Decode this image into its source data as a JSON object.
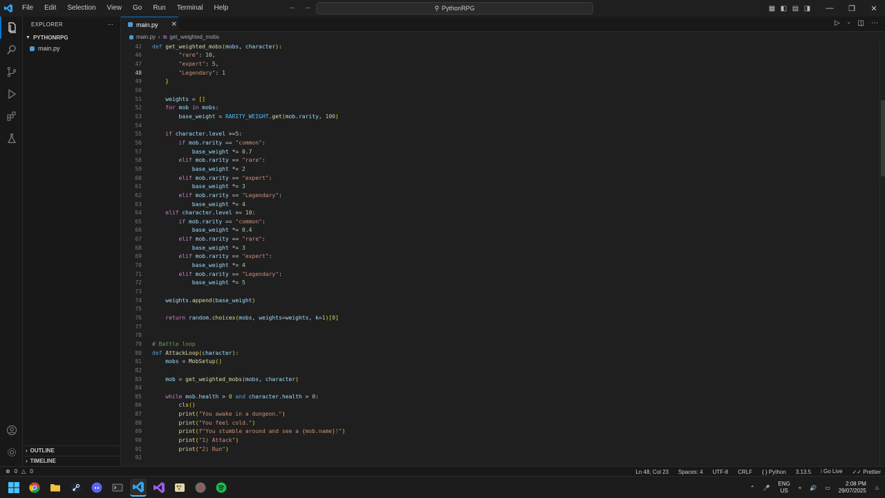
{
  "menu": [
    "File",
    "Edit",
    "Selection",
    "View",
    "Go",
    "Run",
    "Terminal",
    "Help"
  ],
  "search": {
    "label": "PythonRPG"
  },
  "sidebar": {
    "title": "EXPLORER",
    "folder": "PYTHONRPG",
    "file": "main.py",
    "outline": "OUTLINE",
    "timeline": "TIMELINE"
  },
  "tab": {
    "label": "main.py"
  },
  "breadcrumb": {
    "file": "main.py",
    "symbol": "get_weighted_mobs"
  },
  "code": {
    "current_line": "48",
    "lines": [
      {
        "n": "42",
        "t": "def get_weighted_mobs(mobs, character):"
      },
      {
        "n": "46",
        "t": "        \"rare\": 10,"
      },
      {
        "n": "47",
        "t": "        \"expert\": 5,"
      },
      {
        "n": "48",
        "t": "        \"Legendary\": 1"
      },
      {
        "n": "49",
        "t": "    }"
      },
      {
        "n": "50",
        "t": ""
      },
      {
        "n": "51",
        "t": "    weights = []"
      },
      {
        "n": "52",
        "t": "    for mob in mobs:"
      },
      {
        "n": "53",
        "t": "        base_weight = RARITY_WEIGHT.get(mob.rarity, 100)"
      },
      {
        "n": "54",
        "t": ""
      },
      {
        "n": "55",
        "t": "    if character.level >=5:"
      },
      {
        "n": "56",
        "t": "        if mob.rarity == \"common\":"
      },
      {
        "n": "57",
        "t": "            base_weight *= 0.7"
      },
      {
        "n": "58",
        "t": "        elif mob.rarity == \"rare\":"
      },
      {
        "n": "59",
        "t": "            base_weight *= 2"
      },
      {
        "n": "60",
        "t": "        elif mob.rarity == \"expert\":"
      },
      {
        "n": "61",
        "t": "            base_weight *= 3"
      },
      {
        "n": "62",
        "t": "        elif mob.rarity == \"Legendary\":"
      },
      {
        "n": "63",
        "t": "            base_weight *= 4"
      },
      {
        "n": "64",
        "t": "    elif character.level >= 10:"
      },
      {
        "n": "65",
        "t": "        if mob.rarity == \"common\":"
      },
      {
        "n": "66",
        "t": "            base_weight *= 0.4"
      },
      {
        "n": "67",
        "t": "        elif mob.rarity == \"rare\":"
      },
      {
        "n": "68",
        "t": "            base_weight *= 3"
      },
      {
        "n": "69",
        "t": "        elif mob.rarity == \"expert\":"
      },
      {
        "n": "70",
        "t": "            base_weight *= 4"
      },
      {
        "n": "71",
        "t": "        elif mob.rarity == \"Legendary\":"
      },
      {
        "n": "72",
        "t": "            base_weight *= 5"
      },
      {
        "n": "73",
        "t": ""
      },
      {
        "n": "74",
        "t": "    weights.append(base_weight)"
      },
      {
        "n": "75",
        "t": ""
      },
      {
        "n": "76",
        "t": "    return random.choices(mobs, weights=weights, k=1)[0]"
      },
      {
        "n": "77",
        "t": ""
      },
      {
        "n": "78",
        "t": ""
      },
      {
        "n": "79",
        "t": "# Battle loop"
      },
      {
        "n": "80",
        "t": "def AttackLoop(character):"
      },
      {
        "n": "81",
        "t": "    mobs = MobSetup()"
      },
      {
        "n": "82",
        "t": ""
      },
      {
        "n": "83",
        "t": "    mob = get_weighted_mobs(mobs, character)"
      },
      {
        "n": "84",
        "t": ""
      },
      {
        "n": "85",
        "t": "    while mob.health > 0 and character.health > 0:"
      },
      {
        "n": "86",
        "t": "        cls()"
      },
      {
        "n": "87",
        "t": "        print(\"You awake in a dungeon.\")"
      },
      {
        "n": "88",
        "t": "        print(\"You feel cold.\")"
      },
      {
        "n": "89",
        "t": "        print(f\"You stumble around and see a {mob.name}!\")"
      },
      {
        "n": "90",
        "t": "        print(\"1) Attack\")"
      },
      {
        "n": "91",
        "t": "        print(\"2) Run\")"
      },
      {
        "n": "92",
        "t": ""
      }
    ]
  },
  "status": {
    "errors": "0",
    "warnings": "0",
    "position": "Ln 48, Col 23",
    "spaces": "Spaces: 4",
    "encoding": "UTF-8",
    "eol": "CRLF",
    "language": "Python",
    "version": "3.13.5",
    "golive": "Go Live",
    "prettier": "Prettier"
  },
  "tray": {
    "lang1": "ENG",
    "lang2": "US",
    "time": "2:08 PM",
    "date": "29/07/2025"
  },
  "colors": {
    "accent": "#0078d4",
    "editor_bg": "#1f1f1f",
    "sidebar_bg": "#181818"
  }
}
